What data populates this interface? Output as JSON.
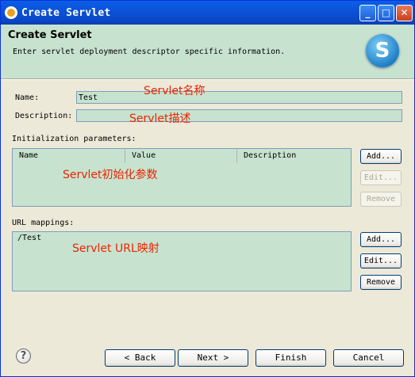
{
  "window": {
    "title": "Create Servlet",
    "controls": {
      "minimize": "_",
      "maximize": "□",
      "close": "✕"
    }
  },
  "header": {
    "title": "Create Servlet",
    "description": "Enter servlet deployment descriptor specific information.",
    "logo_letter": "S"
  },
  "form": {
    "name_label": "Name:",
    "name_value": "Test",
    "description_label": "Description:",
    "description_value": ""
  },
  "init_params": {
    "label": "Initialization parameters:",
    "columns": [
      "Name",
      "Value",
      "Description"
    ],
    "buttons": {
      "add": "Add...",
      "edit": "Edit...",
      "remove": "Remove"
    }
  },
  "url_mappings": {
    "label": "URL mappings:",
    "items": [
      "/Test"
    ],
    "buttons": {
      "add": "Add...",
      "edit": "Edit...",
      "remove": "Remove"
    }
  },
  "annotations": {
    "name": "Servlet名称",
    "description": "Servlet描述",
    "init": "Servlet初始化参数",
    "url": "Servlet URL映射"
  },
  "footer": {
    "help": "?",
    "back": "< Back",
    "next": "Next >",
    "finish": "Finish",
    "cancel": "Cancel"
  },
  "colors": {
    "field_bg": "#c7e3cf",
    "dialog_bg": "#ece9d8",
    "annotation": "#ee2200",
    "titlebar": "#0a5fe8"
  }
}
